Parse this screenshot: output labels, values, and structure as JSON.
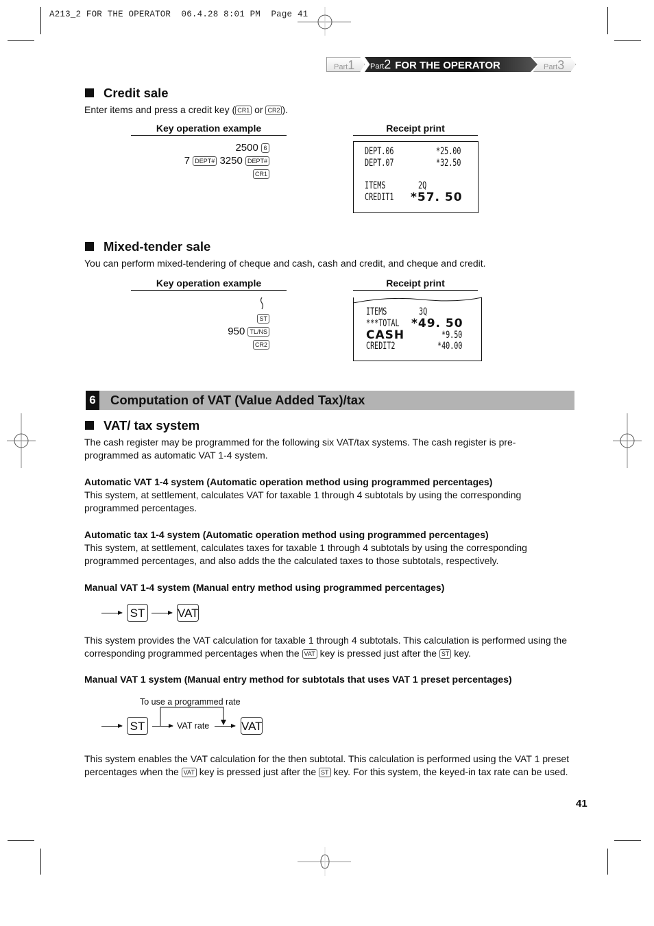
{
  "slug": "A213_2 FOR THE OPERATOR  06.4.28 8:01 PM  Page 41",
  "part_nav": {
    "part1": {
      "prefix": "Part",
      "num": "1"
    },
    "part2": {
      "prefix": "Part",
      "num": "2",
      "title": "FOR THE OPERATOR"
    },
    "part3": {
      "prefix": "Part",
      "num": "3"
    }
  },
  "credit_sale": {
    "heading": "Credit sale",
    "intro_before": "Enter items and press a credit key (",
    "key1": "CR1",
    "intro_mid": " or ",
    "key2": "CR2",
    "intro_after": ").",
    "key_op_header": "Key operation example",
    "receipt_header": "Receipt print",
    "key_lines": [
      {
        "pre": "",
        "amount": "2500",
        "key": "6"
      },
      {
        "pre": "7",
        "pre_key": "DEPT#",
        "amount": "3250",
        "key": "DEPT#"
      },
      {
        "key": "CR1"
      }
    ],
    "receipt": [
      {
        "label": "DEPT.06",
        "value": "*25.00"
      },
      {
        "label": "DEPT.07",
        "value": "*32.50"
      },
      {
        "label": "ITEMS",
        "value": "2Q"
      },
      {
        "label": "CREDIT1",
        "value": "*57. 50"
      }
    ]
  },
  "mixed_tender": {
    "heading": "Mixed-tender sale",
    "intro": "You can perform mixed-tendering of cheque and cash, cash and credit, and cheque and credit.",
    "key_op_header": "Key operation example",
    "receipt_header": "Receipt print",
    "key_lines": [
      {
        "key": "ST"
      },
      {
        "amount": "950",
        "key": "TL/NS"
      },
      {
        "key": "CR2"
      }
    ],
    "receipt": [
      {
        "label": "ITEMS",
        "value": "3Q"
      },
      {
        "label": "***TOTAL",
        "value": "*49. 50"
      },
      {
        "label": "CASH",
        "value": "*9.50"
      },
      {
        "label": "CREDIT2",
        "value": "*40.00"
      }
    ]
  },
  "section": {
    "number": "6",
    "title": "Computation of VAT (Value Added Tax)/tax"
  },
  "vat_system": {
    "heading": "VAT/ tax system",
    "intro": "The cash register may be programmed for the following six VAT/tax systems.  The cash register is pre-programmed as automatic VAT 1-4 system.",
    "auto_vat": {
      "title": "Automatic VAT 1-4 system (Automatic operation method using programmed percentages)",
      "body": "This system, at settlement, calculates VAT for taxable 1 through 4 subtotals by using the corresponding programmed percentages."
    },
    "auto_tax": {
      "title": "Automatic tax 1-4 system (Automatic operation method using programmed percentages)",
      "body": "This system, at settlement, calculates taxes for taxable 1 through 4 subtotals by using the corresponding programmed percentages, and also adds the the calculated taxes to those subtotals, respectively."
    },
    "manual_vat14": {
      "title": "Manual VAT 1-4 system (Manual entry method using programmed percentages)",
      "flow_keys": [
        "ST",
        "VAT"
      ],
      "body_1": "This system provides the VAT calculation for taxable 1 through 4 subtotals. This calculation is performed using the corresponding programmed percentages when the ",
      "key_vat": "VAT",
      "body_2": " key is pressed just after the ",
      "key_st": "ST",
      "body_3": " key."
    },
    "manual_vat1": {
      "title": "Manual VAT 1 system (Manual entry method for subtotals that uses VAT 1 preset percentages)",
      "flow_note": "To use a programmed rate",
      "flow_keys": [
        "ST",
        "VAT"
      ],
      "flow_mid": "VAT rate",
      "body_1": "This system enables the VAT calculation for the then subtotal. This calculation is performed using the VAT 1 preset percentages when the ",
      "key_vat": "VAT",
      "body_2": " key is pressed just after the ",
      "key_st": "ST",
      "body_3": " key. For this system, the keyed-in tax rate can be used."
    }
  },
  "page_number": "41"
}
